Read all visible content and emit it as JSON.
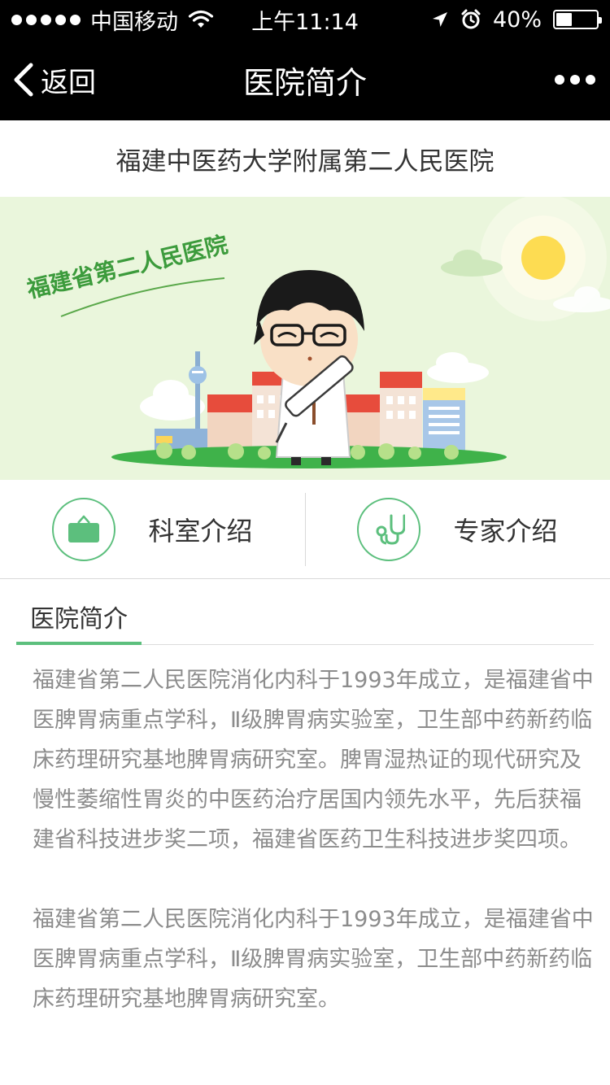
{
  "status_bar": {
    "carrier": "中国移动",
    "time": "上午11:14",
    "battery": "40%",
    "battery_level": 0.4
  },
  "nav": {
    "back_label": "返回",
    "title": "医院简介"
  },
  "hospital_name": "福建中医药大学附属第二人民医院",
  "banner": {
    "slogan": "福建省第二人民医院"
  },
  "quick_entries": [
    {
      "label": "科室介绍",
      "icon": "briefcase-icon"
    },
    {
      "label": "专家介绍",
      "icon": "stethoscope-icon"
    }
  ],
  "section_tab": "医院简介",
  "article": {
    "paragraphs": [
      "福建省第二人民医院消化内科于1993年成立，是福建省中医脾胃病重点学科，Ⅱ级脾胃病实验室，卫生部中药新药临床药理研究基地脾胃病研究室。脾胃湿热证的现代研究及慢性萎缩性胃炎的中医药治疗居国内领先水平，先后获福建省科技进步奖二项，福建省医药卫生科技进步奖四项。",
      "福建省第二人民医院消化内科于1993年成立，是福建省中医脾胃病重点学科，Ⅱ级脾胃病实验室，卫生部中药新药临床药理研究基地脾胃病研究室。"
    ]
  },
  "colors": {
    "accent": "#5cbf7d",
    "bar": "#000000",
    "text": "#333333",
    "muted_text": "#8c8c8c"
  }
}
